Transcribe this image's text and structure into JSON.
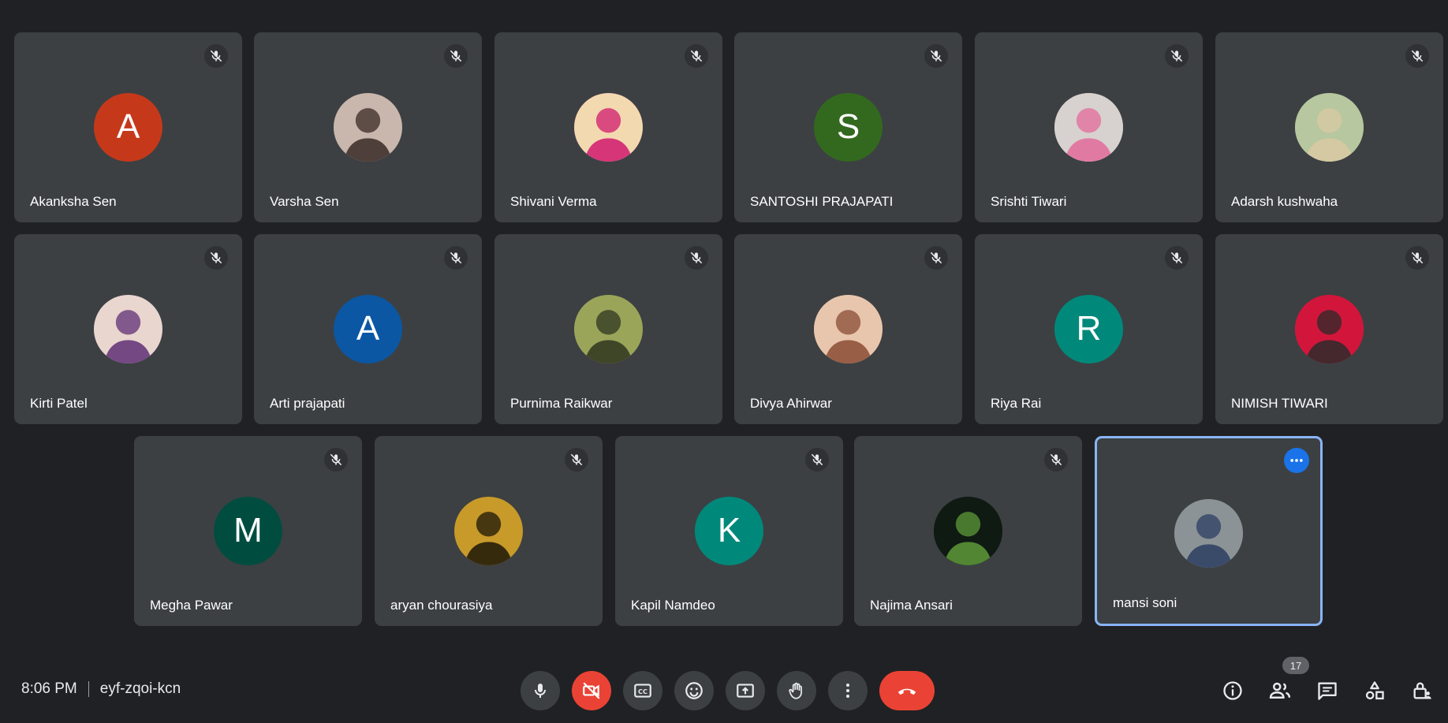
{
  "participants": [
    {
      "name": "Akanksha Sen",
      "initial": "A",
      "color": "#c5391a",
      "photo": false
    },
    {
      "name": "Varsha Sen",
      "initial": "",
      "color": "#6b5a55",
      "photo": true,
      "photo_tones": [
        "#c9b7ad",
        "#3a2a26"
      ]
    },
    {
      "name": "Shivani Verma",
      "initial": "",
      "color": "#c2237b",
      "photo": true,
      "photo_tones": [
        "#f3d9b0",
        "#d0196e"
      ]
    },
    {
      "name": "SANTOSHI PRAJAPATI",
      "initial": "S",
      "color": "#33691e",
      "photo": false
    },
    {
      "name": "Srishti Tiwari",
      "initial": "",
      "color": "#b9b3b0",
      "photo": true,
      "photo_tones": [
        "#d7d2cf",
        "#e36b9b"
      ]
    },
    {
      "name": "Adarsh kushwaha",
      "initial": "",
      "color": "#8ea37a",
      "photo": true,
      "photo_tones": [
        "#b7c79f",
        "#d9c9a2"
      ]
    },
    {
      "name": "Kirti Patel",
      "initial": "",
      "color": "#7a4e8d",
      "photo": true,
      "photo_tones": [
        "#e9d6cf",
        "#5f2f76"
      ]
    },
    {
      "name": "Arti prajapati",
      "initial": "A",
      "color": "#0b57a4",
      "photo": false
    },
    {
      "name": "Purnima Raikwar",
      "initial": "",
      "color": "#5b6a2f",
      "photo": true,
      "photo_tones": [
        "#9aa55a",
        "#2f3520"
      ]
    },
    {
      "name": "Divya Ahirwar",
      "initial": "",
      "color": "#b1826c",
      "photo": true,
      "photo_tones": [
        "#e8c6ad",
        "#8a4b34"
      ]
    },
    {
      "name": "Riya Rai",
      "initial": "R",
      "color": "#00897b",
      "photo": false
    },
    {
      "name": "NIMISH TIWARI",
      "initial": "",
      "color": "#d2163b",
      "photo": true,
      "photo_tones": [
        "#d2163b",
        "#2b2b2b"
      ]
    },
    {
      "name": "Megha Pawar",
      "initial": "M",
      "color": "#004d40",
      "photo": false
    },
    {
      "name": "aryan chourasiya",
      "initial": "",
      "color": "#3a2f16",
      "photo": true,
      "photo_tones": [
        "#c79a2a",
        "#1c1608"
      ]
    },
    {
      "name": "Kapil Namdeo",
      "initial": "K",
      "color": "#00897b",
      "photo": false
    },
    {
      "name": "Najima Ansari",
      "initial": "",
      "color": "#142015",
      "photo": true,
      "photo_tones": [
        "#0f1a12",
        "#5e9a3a"
      ]
    },
    {
      "name": "mansi soni",
      "initial": "",
      "color": "#6f7a7e",
      "photo": true,
      "photo_tones": [
        "#8c9396",
        "#2c3e63"
      ]
    }
  ],
  "meeting": {
    "time": "8:06 PM",
    "code": "eyf-zqoi-kcn"
  },
  "participant_count": "17",
  "controls": {
    "mic_icon": "mic-icon",
    "camera_icon": "camera-off-icon",
    "captions_icon": "captions-icon",
    "emoji_icon": "emoji-icon",
    "present_icon": "present-screen-icon",
    "hand_icon": "raise-hand-icon",
    "more_icon": "more-vert-icon",
    "hangup_icon": "hang-up-icon"
  },
  "colors": {
    "background": "#202124",
    "tile": "#3c4043",
    "active_border": "#8ab4f8",
    "danger": "#ea4335",
    "accent": "#1a73e8"
  }
}
